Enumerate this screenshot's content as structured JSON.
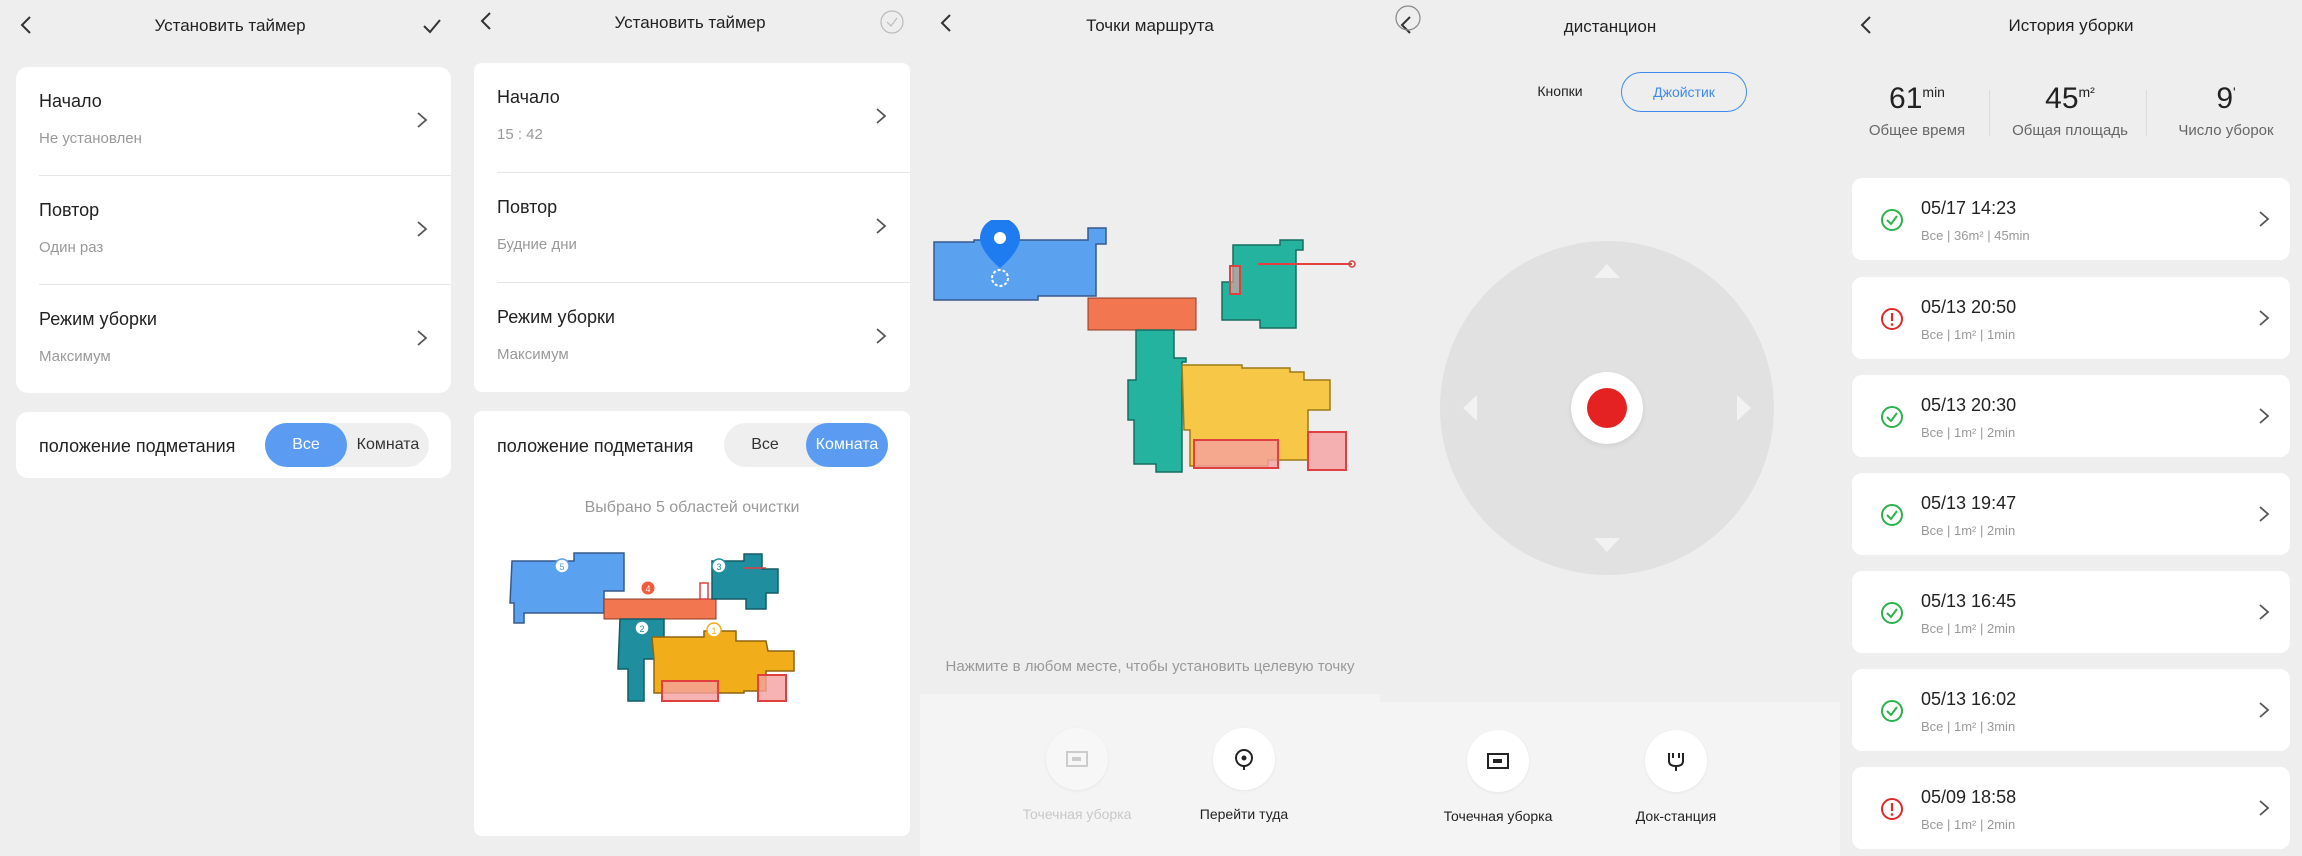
{
  "screen1": {
    "title": "Установить таймер",
    "rows": [
      {
        "label": "Начало",
        "value": "Не установлен"
      },
      {
        "label": "Повтор",
        "value": "Один раз"
      },
      {
        "label": "Режим уборки",
        "value": "Максимум"
      }
    ],
    "sweep_label": "положение подметания",
    "sweep_options": [
      "Все",
      "Комната"
    ],
    "sweep_selected": "Все"
  },
  "screen2": {
    "title": "Установить таймер",
    "rows": [
      {
        "label": "Начало",
        "value": "15 : 42"
      },
      {
        "label": "Повтор",
        "value": "Будние дни"
      },
      {
        "label": "Режим уборки",
        "value": "Максимум"
      }
    ],
    "sweep_label": "положение подметания",
    "sweep_options": [
      "Все",
      "Комната"
    ],
    "sweep_selected": "Комната",
    "selected_note": "Выбрано 5 областей очистки",
    "room_badges": [
      "5",
      "4",
      "3",
      "2",
      "1"
    ]
  },
  "screen3": {
    "title": "Точки маршрута",
    "hint": "Нажмите в любом месте, чтобы установить целевую точку",
    "buttons": [
      {
        "label": "Точечная уборка",
        "icon": "spot-clean-icon",
        "enabled": false
      },
      {
        "label": "Перейти туда",
        "icon": "target-icon",
        "enabled": true
      }
    ]
  },
  "screen4": {
    "title": "дистанцион",
    "tabs": [
      "Кнопки",
      "Джойстик"
    ],
    "active_tab": "Джойстик",
    "stop_color": "#e52222",
    "buttons": [
      {
        "label": "Точечная уборка",
        "icon": "spot-clean-icon"
      },
      {
        "label": "Док-станция",
        "icon": "dock-plug-icon"
      }
    ]
  },
  "screen5": {
    "title": "История уборки",
    "stats": [
      {
        "value": "61",
        "unit": "min",
        "label": "Общее время"
      },
      {
        "value": "45",
        "unit": "m²",
        "label": "Общая площадь"
      },
      {
        "value": "9",
        "unit": "'",
        "label": "Число уборок"
      }
    ],
    "records": [
      {
        "datetime": "05/17 14:23",
        "detail": "Все | 36m² | 45min",
        "status": "ok"
      },
      {
        "datetime": "05/13 20:50",
        "detail": "Все | 1m² | 1min",
        "status": "error"
      },
      {
        "datetime": "05/13 20:30",
        "detail": "Все | 1m² | 2min",
        "status": "ok"
      },
      {
        "datetime": "05/13 19:47",
        "detail": "Все | 1m² | 2min",
        "status": "ok"
      },
      {
        "datetime": "05/13 16:45",
        "detail": "Все | 1m² | 2min",
        "status": "ok"
      },
      {
        "datetime": "05/13 16:02",
        "detail": "Все | 1m² | 3min",
        "status": "ok"
      },
      {
        "datetime": "05/09 18:58",
        "detail": "Все | 1m² | 2min",
        "status": "error"
      }
    ]
  },
  "colors": {
    "accent_blue": "#5b9cf2",
    "ok_green": "#2bb24c",
    "error_red": "#e02a2a",
    "room_blue": "#5aa1f0",
    "room_orange": "#f2764f",
    "room_teal": "#24b39f",
    "room_yellow": "#f7c847",
    "zone_red": "#f06a5e"
  }
}
